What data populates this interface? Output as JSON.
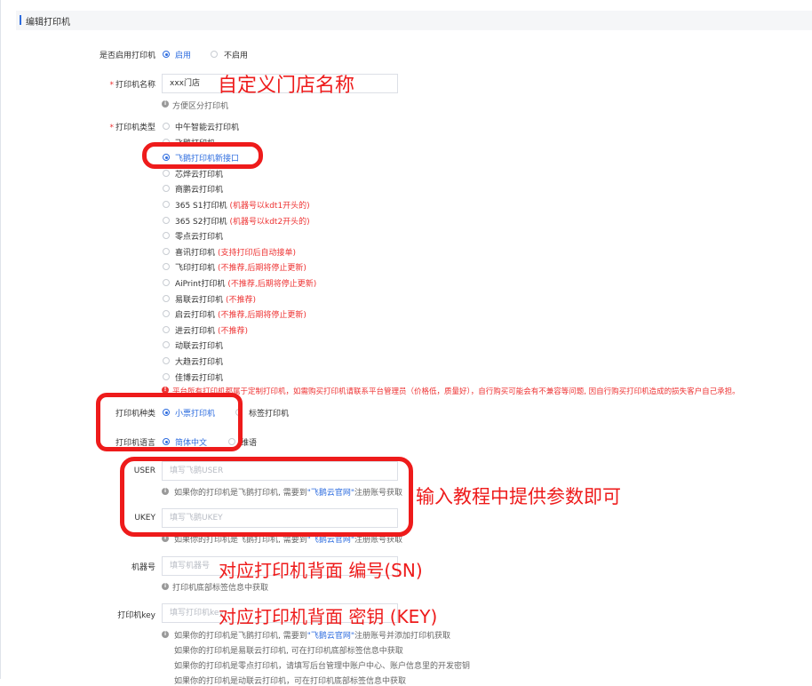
{
  "header": {
    "title": "编辑打印机"
  },
  "enable": {
    "label": "是否启用打印机",
    "options": [
      {
        "label": "启用",
        "selected": true
      },
      {
        "label": "不启用",
        "selected": false
      }
    ]
  },
  "printer_name": {
    "label": "打印机名称",
    "value": "xxx门店",
    "hint": "方便区分打印机"
  },
  "printer_type": {
    "label": "打印机类型",
    "options": [
      {
        "label": "中午智能云打印机",
        "note": ""
      },
      {
        "label": "飞鹅打印机",
        "note": ""
      },
      {
        "label": "飞鹅打印机新接口",
        "note": "",
        "selected": true
      },
      {
        "label": "芯烨云打印机",
        "note": ""
      },
      {
        "label": "商鹏云打印机",
        "note": ""
      },
      {
        "label": "365 S1打印机",
        "note": "(机器号以kdt1开头的)"
      },
      {
        "label": "365 S2打印机",
        "note": "(机器号以kdt2开头的)"
      },
      {
        "label": "零点云打印机",
        "note": ""
      },
      {
        "label": "喜讯打印机",
        "note": "(支持打印后自动接单)"
      },
      {
        "label": "飞印打印机",
        "note": "(不推荐,后期将停止更新)"
      },
      {
        "label": "AiPrint打印机",
        "note": "(不推荐,后期将停止更新)"
      },
      {
        "label": "易联云打印机",
        "note": "(不推荐)"
      },
      {
        "label": "启云打印机",
        "note": "(不推荐,后期将停止更新)"
      },
      {
        "label": "进云打印机",
        "note": "(不推荐)"
      },
      {
        "label": "动联云打印机",
        "note": ""
      },
      {
        "label": "大趋云打印机",
        "note": ""
      },
      {
        "label": "佳博云打印机",
        "note": ""
      }
    ],
    "warning": "平台所有打印机都属于定制打印机，如需购买打印机请联系平台管理员（价格低，质量好），自行购买可能会有不兼容等问题, 因自行购买打印机造成的损失客户自己承担。"
  },
  "printer_kind": {
    "label": "打印机种类",
    "options": [
      {
        "label": "小票打印机",
        "selected": true
      },
      {
        "label": "标签打印机",
        "selected": false
      }
    ]
  },
  "printer_lang": {
    "label": "打印机语言",
    "options": [
      {
        "label": "简体中文",
        "selected": true
      },
      {
        "label": "维语",
        "selected": false
      }
    ]
  },
  "user": {
    "label": "USER",
    "placeholder": "填写飞鹅USER",
    "hint_pre": "如果你的打印机是飞鹅打印机, 需要到",
    "hint_link": "\"飞鹅云官网\"",
    "hint_post": "注册账号获取"
  },
  "ukey": {
    "label": "UKEY",
    "placeholder": "填写飞鹅UKEY",
    "hint_pre": "如果你的打印机是飞鹅打印机, 需要到",
    "hint_link": "\"飞鹅云官网\"",
    "hint_post": "注册账号获取"
  },
  "sn": {
    "label": "机器号",
    "placeholder": "填写机器号",
    "hint": "打印机底部标签信息中获取"
  },
  "pkey": {
    "label": "打印机key",
    "placeholder": "填写打印机key",
    "hint_pre": "如果你的打印机是飞鹅打印机, 需要到",
    "hint_link": "\"飞鹅云官网\"",
    "hint_post": "注册账号并添加打印机获取",
    "lines": [
      "如果你的打印机是易联云打印机, 可在打印机底部标签信息中获取",
      "如果你的打印机是零点打印机，请填写后台管理中账户中心、账户信息里的开发密钥",
      "如果你的打印机是动联云打印机，可在打印机底部标签信息中获取"
    ]
  },
  "annotations": {
    "name": "自定义门店名称",
    "params": "输入教程中提供参数即可",
    "sn": "对应打印机背面 编号(SN)",
    "key": "对应打印机背面 密钥 (KEY)"
  },
  "colors": {
    "accent": "#2d6cdf",
    "annotation": "#ee1b1b",
    "required": "#e33333"
  }
}
